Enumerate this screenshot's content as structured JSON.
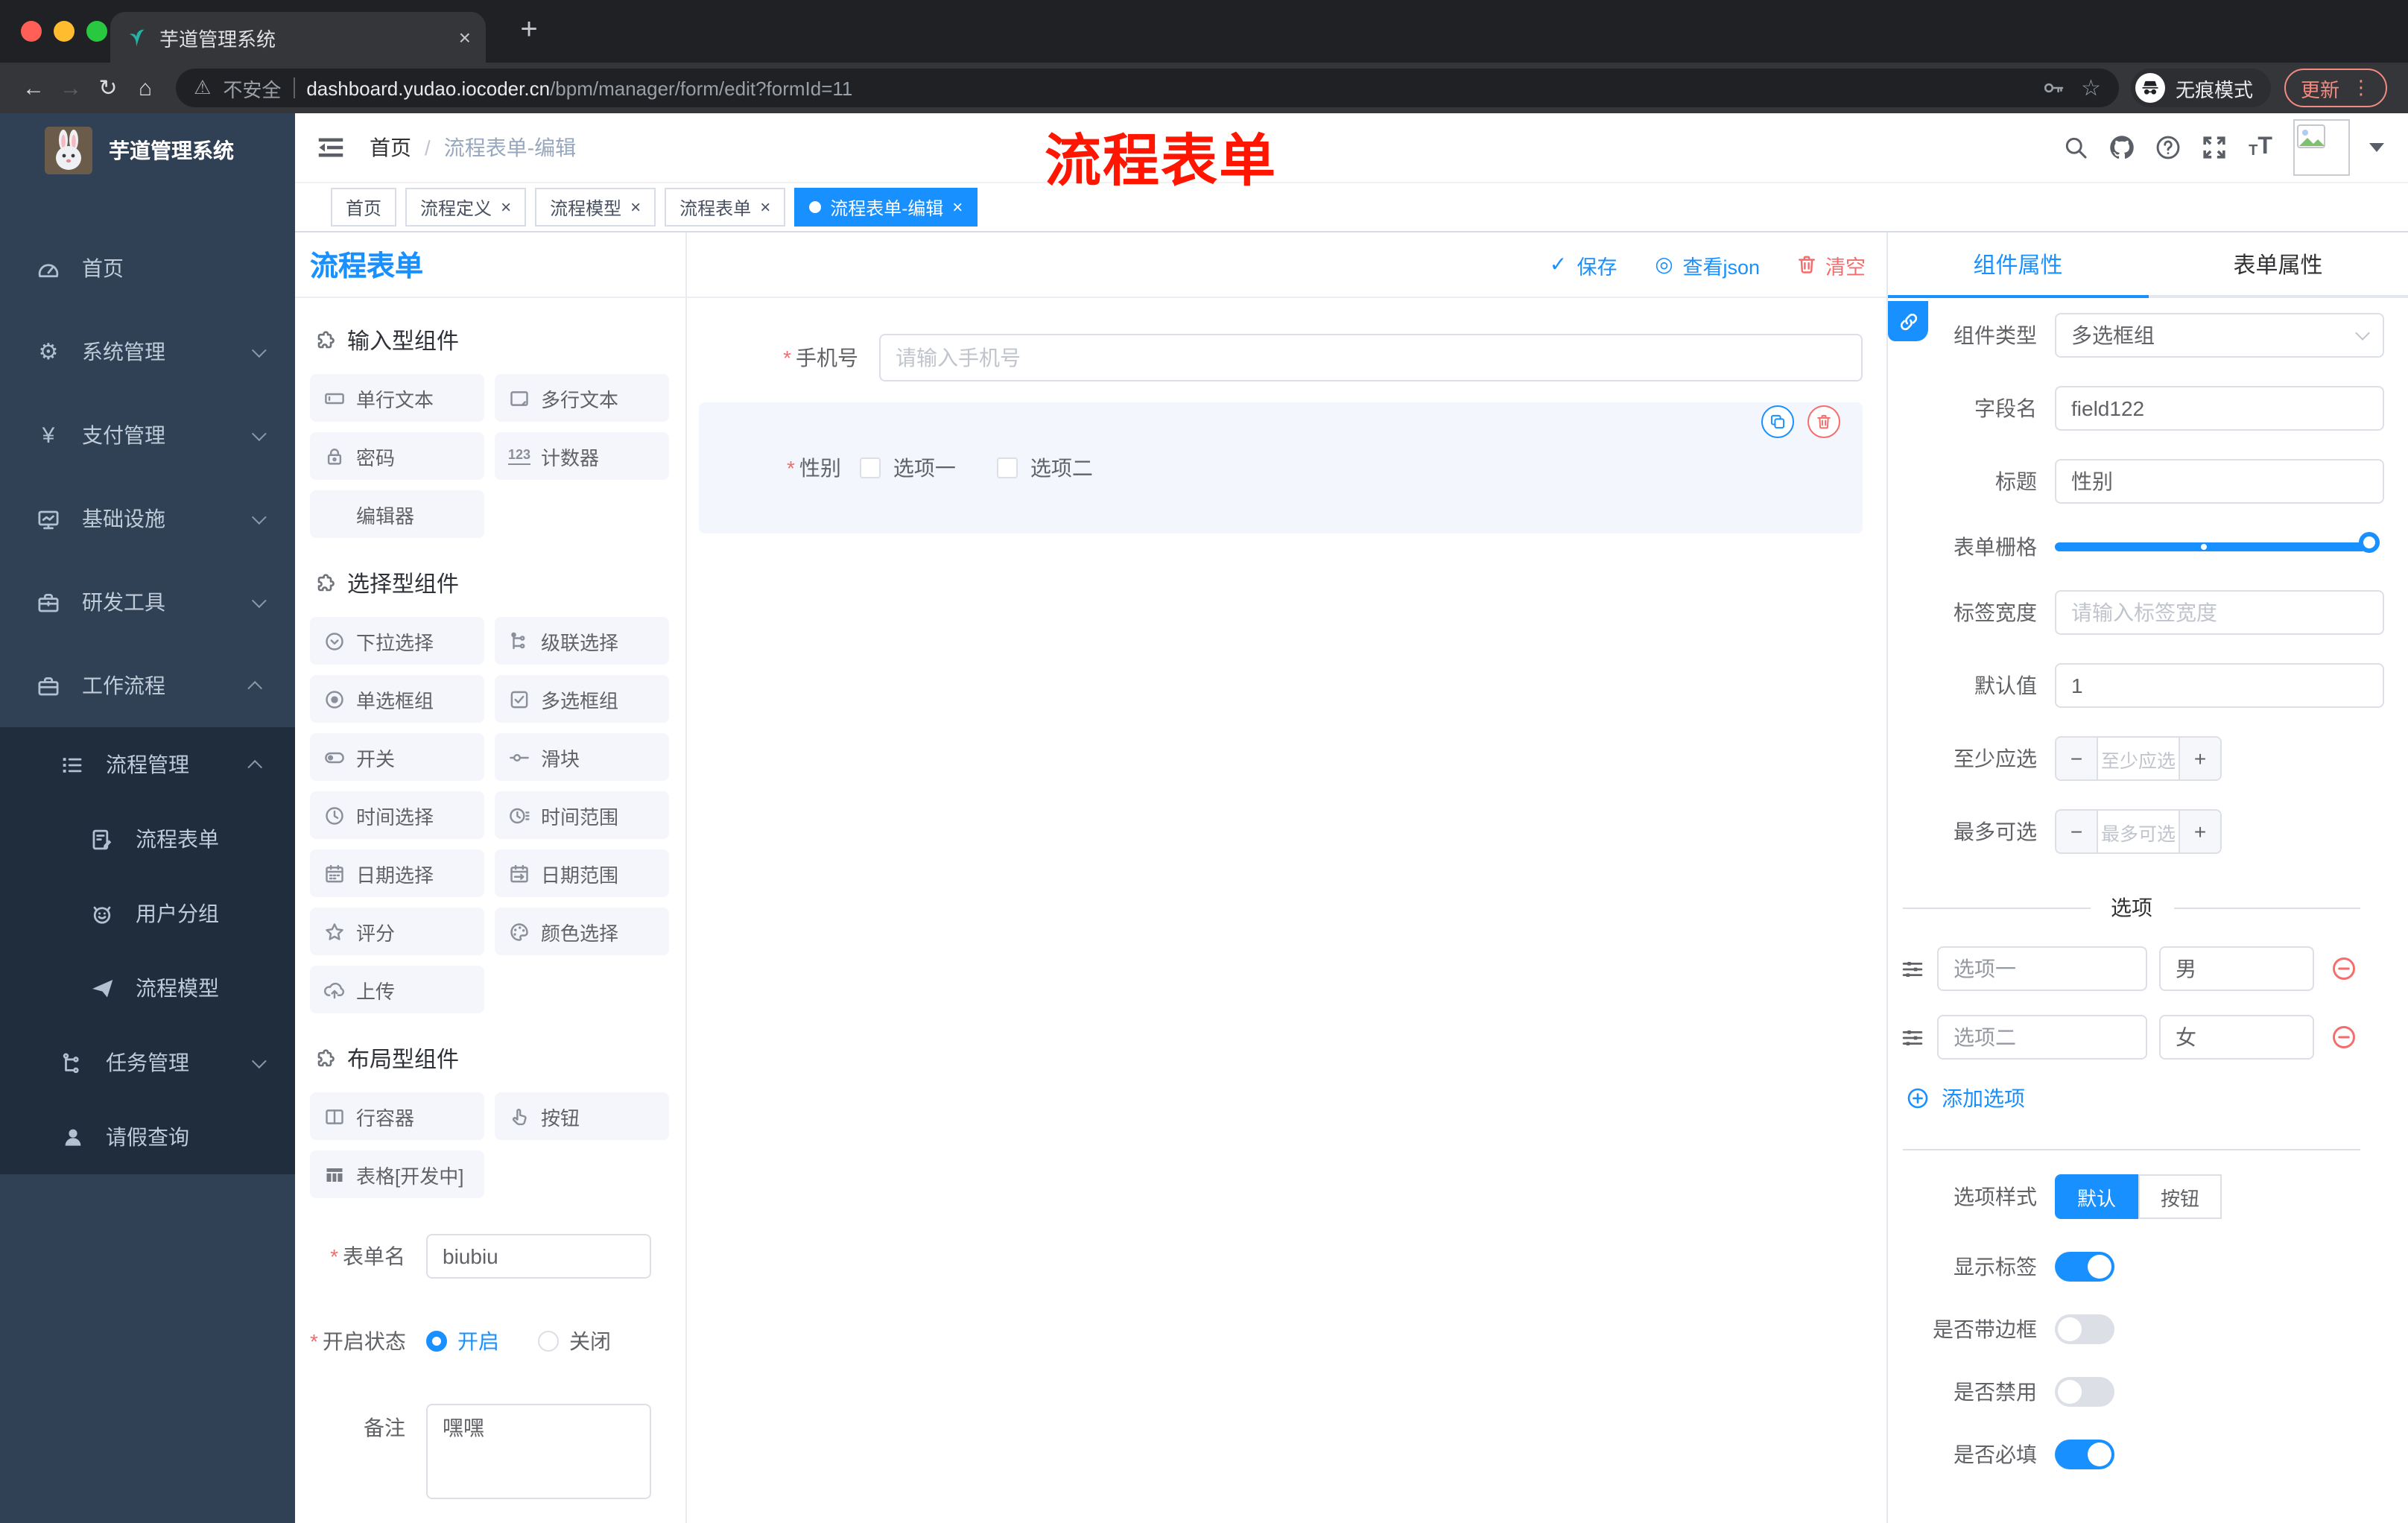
{
  "colors": {
    "primary": "#1890ff",
    "danger": "#f56c6c",
    "sidebar_bg": "#304156",
    "submenu_bg": "#1f2d3d",
    "chrome_bg": "#202124",
    "toolbar_bg": "#35363a",
    "tab_active_bg": "#1890ff"
  },
  "browser": {
    "tab_title": "芋道管理系统",
    "security_label": "不安全",
    "url_host": "dashboard.yudao.iocoder.cn",
    "url_path": "/bpm/manager/form/edit?formId=11",
    "incognito_label": "无痕模式",
    "update_label": "更新"
  },
  "sidebar": {
    "logo_title": "芋道管理系统",
    "items": [
      {
        "label": "首页",
        "icon": "dashboard",
        "level": 1
      },
      {
        "label": "系统管理",
        "icon": "gear",
        "level": 1,
        "chevron": "down"
      },
      {
        "label": "支付管理",
        "icon": "yen",
        "level": 1,
        "chevron": "down"
      },
      {
        "label": "基础设施",
        "icon": "monitor",
        "level": 1,
        "chevron": "down"
      },
      {
        "label": "研发工具",
        "icon": "toolbox",
        "level": 1,
        "chevron": "down"
      },
      {
        "label": "工作流程",
        "icon": "briefcase",
        "level": 1,
        "chevron": "up"
      },
      {
        "label": "流程管理",
        "icon": "tree-list",
        "level": 2,
        "chevron": "up",
        "sub": true
      },
      {
        "label": "流程表单",
        "icon": "form-doc",
        "level": 3,
        "sub": true
      },
      {
        "label": "用户分组",
        "icon": "robot",
        "level": 3,
        "sub": true
      },
      {
        "label": "流程模型",
        "icon": "paper-plane",
        "level": 3,
        "sub": true
      },
      {
        "label": "任务管理",
        "icon": "org-tree",
        "level": 2,
        "chevron": "down",
        "sub": true
      },
      {
        "label": "请假查询",
        "icon": "user",
        "level": 2,
        "sub": true
      }
    ]
  },
  "navbar": {
    "breadcrumb": {
      "root": "首页",
      "separator": "/",
      "current": "流程表单-编辑"
    },
    "overlay_title": "流程表单"
  },
  "tags": {
    "items": [
      {
        "label": "首页",
        "closable": false,
        "active": false
      },
      {
        "label": "流程定义",
        "closable": true,
        "active": false
      },
      {
        "label": "流程模型",
        "closable": true,
        "active": false
      },
      {
        "label": "流程表单",
        "closable": true,
        "active": false
      },
      {
        "label": "流程表单-编辑",
        "closable": true,
        "active": true
      }
    ]
  },
  "designer": {
    "title": "流程表单",
    "toolbar": {
      "save": "保存",
      "view_json": "查看json",
      "clear": "清空"
    },
    "palette": {
      "sections": [
        {
          "title": "输入型组件",
          "items": [
            {
              "label": "单行文本",
              "icon": "input"
            },
            {
              "label": "多行文本",
              "icon": "textarea"
            },
            {
              "label": "密码",
              "icon": "lock"
            },
            {
              "label": "计数器",
              "icon": "counter"
            },
            {
              "label": "编辑器",
              "icon": "none"
            }
          ]
        },
        {
          "title": "选择型组件",
          "items": [
            {
              "label": "下拉选择",
              "icon": "select"
            },
            {
              "label": "级联选择",
              "icon": "cascade"
            },
            {
              "label": "单选框组",
              "icon": "radio"
            },
            {
              "label": "多选框组",
              "icon": "checkbox"
            },
            {
              "label": "开关",
              "icon": "switch"
            },
            {
              "label": "滑块",
              "icon": "slider"
            },
            {
              "label": "时间选择",
              "icon": "clock"
            },
            {
              "label": "时间范围",
              "icon": "time-range"
            },
            {
              "label": "日期选择",
              "icon": "calendar"
            },
            {
              "label": "日期范围",
              "icon": "date-range"
            },
            {
              "label": "评分",
              "icon": "star"
            },
            {
              "label": "颜色选择",
              "icon": "palette"
            },
            {
              "label": "上传",
              "icon": "upload"
            }
          ]
        },
        {
          "title": "布局型组件",
          "items": [
            {
              "label": "行容器",
              "icon": "row-container"
            },
            {
              "label": "按钮",
              "icon": "hand"
            },
            {
              "label": "表格[开发中]",
              "icon": "table"
            }
          ]
        }
      ]
    },
    "meta": {
      "name_label": "表单名",
      "name_value": "biubiu",
      "status_label": "开启状态",
      "status_on": "开启",
      "status_off": "关闭",
      "remark_label": "备注",
      "remark_value": "嘿嘿"
    },
    "canvas": {
      "phone": {
        "label": "手机号",
        "placeholder": "请输入手机号"
      },
      "gender": {
        "label": "性别",
        "options": [
          {
            "label": "选项一"
          },
          {
            "label": "选项二"
          }
        ]
      }
    }
  },
  "inspector": {
    "tab_component": "组件属性",
    "tab_form": "表单属性",
    "component_type": {
      "label": "组件类型",
      "value": "多选框组"
    },
    "field_name": {
      "label": "字段名",
      "value": "field122"
    },
    "title": {
      "label": "标题",
      "value": "性别"
    },
    "grid": {
      "label": "表单栅格"
    },
    "label_width": {
      "label": "标签宽度",
      "placeholder": "请输入标签宽度"
    },
    "default_value": {
      "label": "默认值",
      "value": "1"
    },
    "min_select": {
      "label": "至少应选",
      "placeholder": "至少应选"
    },
    "max_select": {
      "label": "最多可选",
      "placeholder": "最多可选"
    },
    "options_title": "选项",
    "options": [
      {
        "label": "选项一",
        "value": "男"
      },
      {
        "label": "选项二",
        "value": "女"
      }
    ],
    "add_option": "添加选项",
    "option_style": {
      "label": "选项样式",
      "choices": [
        {
          "label": "默认",
          "active": true
        },
        {
          "label": "按钮",
          "active": false
        }
      ]
    },
    "switches": [
      {
        "label": "显示标签",
        "on": true
      },
      {
        "label": "是否带边框",
        "on": false
      },
      {
        "label": "是否禁用",
        "on": false
      },
      {
        "label": "是否必填",
        "on": true
      }
    ]
  }
}
